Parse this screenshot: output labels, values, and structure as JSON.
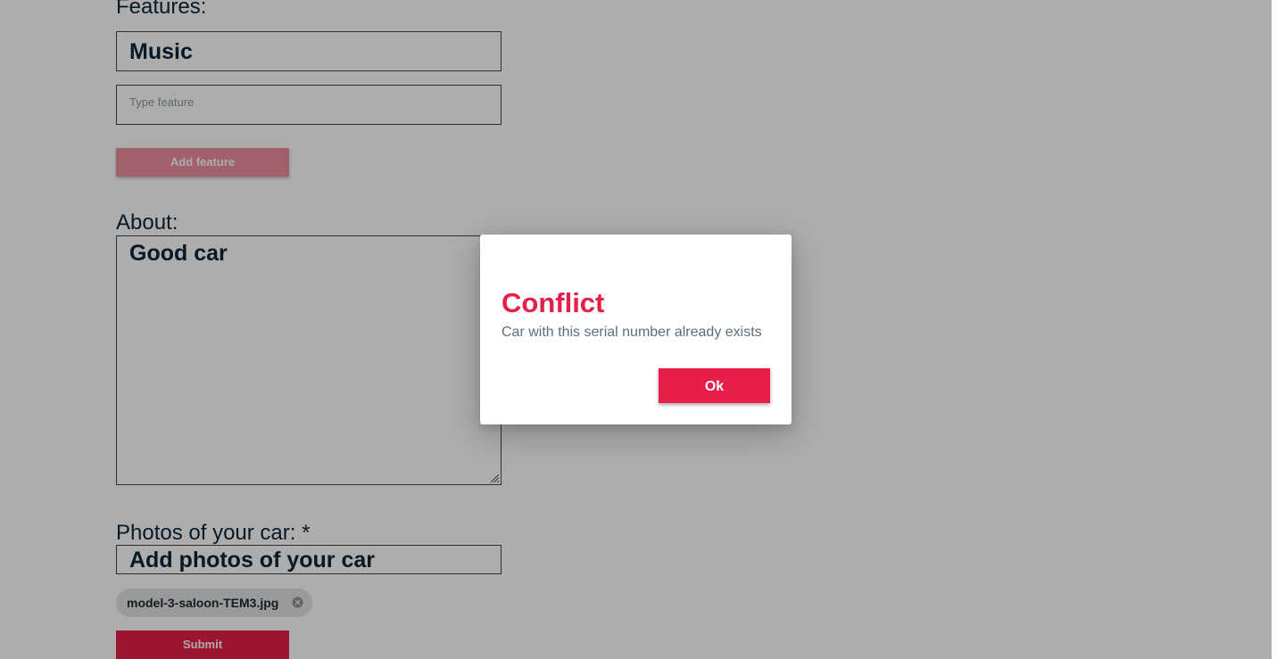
{
  "features": {
    "label": "Features:",
    "items": [
      "Music"
    ],
    "input_placeholder": "Type feature",
    "add_button_label": "Add feature"
  },
  "about": {
    "label": "About:",
    "value": "Good car"
  },
  "photos": {
    "label": "Photos of your car: *",
    "upload_label": "Add photos of your car",
    "files": [
      "model-3-saloon-TEM3.jpg"
    ]
  },
  "submit_label": "Submit",
  "dialog": {
    "title": "Conflict",
    "message": "Car with this serial number already exists",
    "ok_label": "Ok"
  },
  "colors": {
    "accent": "#e61e48",
    "text_dark": "#0c2538",
    "text_muted": "#5c6d7c"
  }
}
